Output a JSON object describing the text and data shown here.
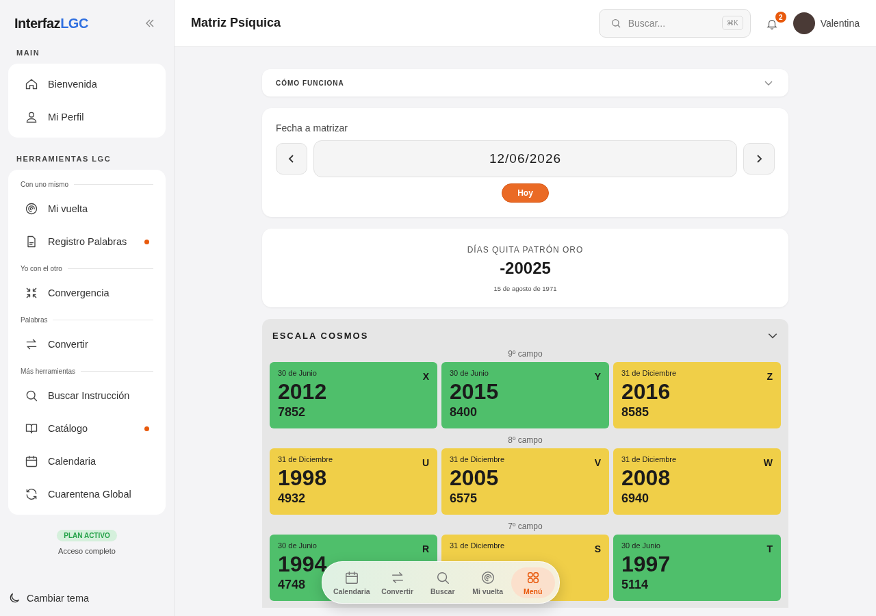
{
  "sidebar": {
    "logo": {
      "main": "Interfaz",
      "accent": "LGC"
    },
    "sections": [
      {
        "title": "MAIN",
        "groups": [
          {
            "items": [
              {
                "label": "Bienvenida",
                "dot": false
              },
              {
                "label": "Mi Perfil",
                "dot": false
              }
            ]
          }
        ]
      },
      {
        "title": "HERRAMIENTAS LGC",
        "groups": [
          {
            "label": "Con uno mismo",
            "items": [
              {
                "label": "Mi vuelta",
                "dot": false
              },
              {
                "label": "Registro Palabras",
                "dot": true
              }
            ]
          },
          {
            "label": "Yo con el otro",
            "items": [
              {
                "label": "Convergencia",
                "dot": false
              }
            ]
          },
          {
            "label": "Palabras",
            "items": [
              {
                "label": "Convertir",
                "dot": false
              }
            ]
          },
          {
            "label": "Más herramientas",
            "items": [
              {
                "label": "Buscar Instrucción",
                "dot": false
              },
              {
                "label": "Catálogo",
                "dot": true
              },
              {
                "label": "Calendaria",
                "dot": false
              },
              {
                "label": "Cuarentena Global",
                "dot": false
              }
            ]
          }
        ]
      }
    ],
    "plan": {
      "badge": "PLAN ACTIVO",
      "text": "Acceso completo"
    },
    "theme_toggle": "Cambiar tema"
  },
  "header": {
    "title": "Matriz Psíquica",
    "search": {
      "placeholder": "Buscar...",
      "shortcut": "⌘K"
    },
    "notifications": "2",
    "user": "Valentina"
  },
  "how_it_works": {
    "title": "CÓMO FUNCIONA",
    "expanded": false
  },
  "date_picker": {
    "label": "Fecha a matrizar",
    "value": "12/06/2026",
    "today_button": "Hoy"
  },
  "gold_days": {
    "title": "DÍAS QUITA PATRÓN ORO",
    "value": "-20025",
    "date": "15 de agosto de 1971"
  },
  "cosmos": {
    "title": "ESCALA COSMOS",
    "expanded": true,
    "fields": [
      {
        "label": "9º campo",
        "cards": [
          {
            "date": "30 de Junio",
            "year": "2012",
            "number": "7852",
            "letter": "X",
            "color": "#4fbf6b"
          },
          {
            "date": "30 de Junio",
            "year": "2015",
            "number": "8400",
            "letter": "Y",
            "color": "#4fbf6b"
          },
          {
            "date": "31 de Diciembre",
            "year": "2016",
            "number": "8585",
            "letter": "Z",
            "color": "#f0cf48"
          }
        ]
      },
      {
        "label": "8º campo",
        "cards": [
          {
            "date": "31 de Diciembre",
            "year": "1998",
            "number": "4932",
            "letter": "U",
            "color": "#f0cf48"
          },
          {
            "date": "31 de Diciembre",
            "year": "2005",
            "number": "6575",
            "letter": "V",
            "color": "#f0cf48"
          },
          {
            "date": "31 de Diciembre",
            "year": "2008",
            "number": "6940",
            "letter": "W",
            "color": "#f0cf48"
          }
        ]
      },
      {
        "label": "7º campo",
        "cards": [
          {
            "date": "30 de Junio",
            "year": "1994",
            "number": "4748",
            "letter": "R",
            "color": "#4fbf6b"
          },
          {
            "date": "31 de Diciembre",
            "letter": "S",
            "color": "#f0cf48"
          },
          {
            "date": "30 de Junio",
            "year": "1997",
            "number": "5114",
            "letter": "T",
            "color": "#4fbf6b"
          }
        ]
      }
    ]
  },
  "bottom_nav": [
    {
      "label": "Calendaria",
      "selected": false
    },
    {
      "label": "Convertir",
      "selected": false
    },
    {
      "label": "Buscar",
      "selected": false
    },
    {
      "label": "Mi vuelta",
      "selected": false
    },
    {
      "label": "Menú",
      "selected": true
    }
  ]
}
